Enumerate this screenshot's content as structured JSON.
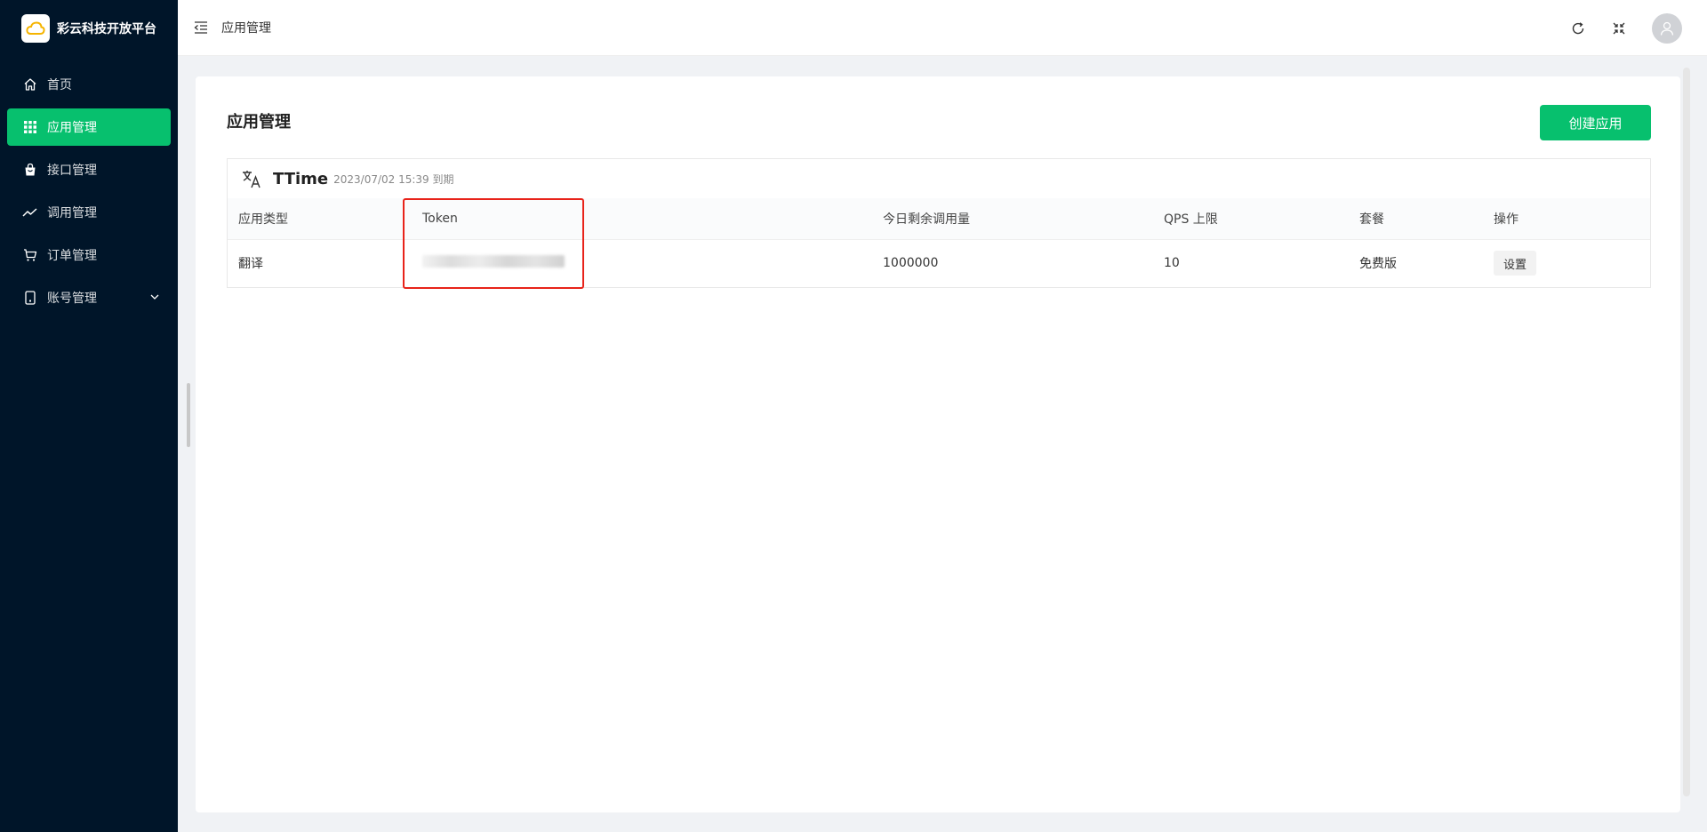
{
  "sidebar": {
    "brand_title": "彩云科技开放平台",
    "items": [
      {
        "label": "首页",
        "icon": "home-icon",
        "active": false
      },
      {
        "label": "应用管理",
        "icon": "grid-icon",
        "active": true
      },
      {
        "label": "接口管理",
        "icon": "shopping-bag-icon",
        "active": false
      },
      {
        "label": "调用管理",
        "icon": "trend-line-icon",
        "active": false
      },
      {
        "label": "订单管理",
        "icon": "cart-icon",
        "active": false
      },
      {
        "label": "账号管理",
        "icon": "phone-icon",
        "active": false
      }
    ]
  },
  "header": {
    "breadcrumb": "应用管理",
    "icons": [
      "refresh-icon",
      "fullscreen-icon",
      "user-avatar-icon"
    ]
  },
  "main": {
    "page_title": "应用管理",
    "create_button": "创建应用",
    "app": {
      "name": "TTime",
      "expire": "2023/07/02 15:39 到期",
      "columns": [
        "应用类型",
        "Token",
        "今日剩余调用量",
        "QPS 上限",
        "套餐",
        "操作"
      ],
      "row": {
        "type": "翻译",
        "token": "",
        "remaining": "1000000",
        "qps": "10",
        "plan": "免费版",
        "action": "设置"
      }
    }
  },
  "colors": {
    "sidebar_bg": "#001529",
    "accent": "#07c06e",
    "highlight": "#e8231a"
  }
}
